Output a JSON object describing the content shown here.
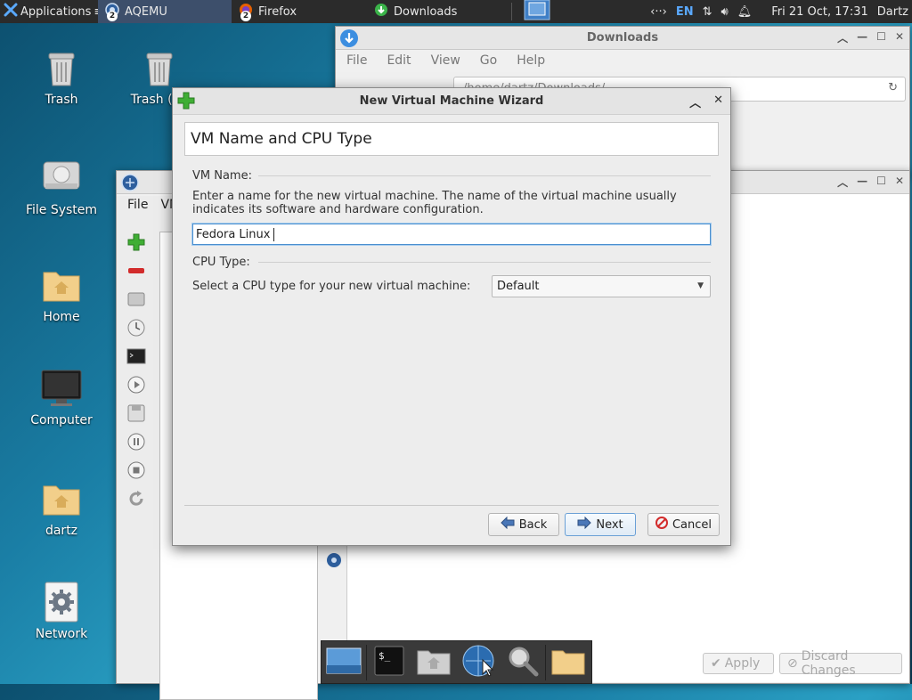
{
  "top_panel": {
    "applications_label": "Applications",
    "tasks": [
      {
        "label": "AQEMU",
        "badge": "2"
      },
      {
        "label": "Firefox",
        "badge": "2"
      },
      {
        "label": "Downloads"
      }
    ],
    "keyboard_layout": "EN",
    "clock": "Fri 21 Oct, 17:31",
    "user": "Dartz"
  },
  "desktop": {
    "icons": [
      {
        "label": "Trash",
        "icon": "trash-icon"
      },
      {
        "label": "Trash (En",
        "icon": "trash-icon"
      },
      {
        "label": "File System",
        "icon": "drive-icon"
      },
      {
        "label": "Home",
        "icon": "home-folder-icon"
      },
      {
        "label": "Computer",
        "icon": "monitor-icon"
      },
      {
        "label": "dartz",
        "icon": "home-folder-icon"
      },
      {
        "label": "Network",
        "icon": "network-gear-icon"
      }
    ]
  },
  "downloads_window": {
    "title": "Downloads",
    "menu": [
      "File",
      "Edit",
      "View",
      "Go",
      "Help"
    ],
    "path": "/home/dartz/Downloads/"
  },
  "aqemu_window": {
    "menu": [
      "File",
      "VM"
    ],
    "apply_label": "Apply",
    "discard_label": "Discard Changes"
  },
  "wizard": {
    "title": "New Virtual Machine Wizard",
    "header": "VM Name and CPU Type",
    "vm_name_group": "VM Name:",
    "vm_name_desc": "Enter a name for the new virtual machine. The name of the virtual machine usually indicates its software and hardware configuration.",
    "vm_name_value": "Fedora Linux",
    "cpu_group": "CPU Type:",
    "cpu_desc": "Select a CPU type for your new virtual machine:",
    "cpu_value": "Default",
    "back_label": "Back",
    "next_label": "Next",
    "cancel_label": "Cancel"
  },
  "colors": {
    "panel_bg": "#2b2b2b",
    "accent": "#4a8fcf",
    "desktop_bg": "#1a7ea5"
  }
}
